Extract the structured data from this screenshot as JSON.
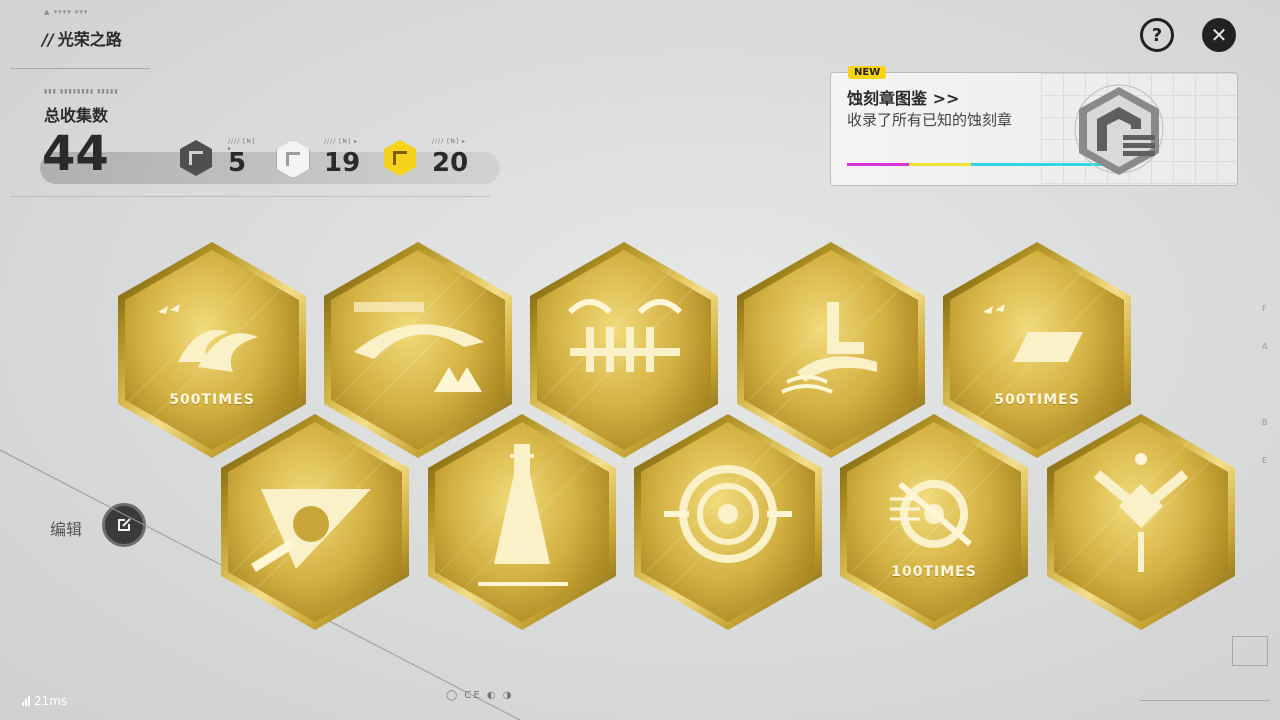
{
  "header": {
    "title_prefix": "//",
    "title": "光荣之路",
    "help_symbol": "?",
    "close_symbol": "✕",
    "logo_text": "▲ ▾▾▾▾ ▾▾▾"
  },
  "summary": {
    "label": "总收集数",
    "total": "44",
    "tiers": [
      {
        "name": "dark",
        "count": "5",
        "tiny": "//// [N] ▸"
      },
      {
        "name": "silver",
        "count": "19",
        "tiny": "//// [N] ▸"
      },
      {
        "name": "gold",
        "count": "20",
        "tiny": "//// [N] ▸"
      }
    ]
  },
  "codex": {
    "badge": "NEW",
    "title": "蚀刻章图鉴 >>",
    "description": "收录了所有已知的蚀刻章",
    "stripe_colors": [
      "#d632e0",
      "#f2e233",
      "#2fd7e6"
    ]
  },
  "edit": {
    "label": "编辑"
  },
  "badges": [
    {
      "id": "b1",
      "label": "500TIMES",
      "motif": "waves"
    },
    {
      "id": "b2",
      "label": "",
      "motif": "mountain"
    },
    {
      "id": "b3",
      "label": "",
      "motif": "pipes"
    },
    {
      "id": "b4",
      "label": "",
      "motif": "stairs"
    },
    {
      "id": "b5",
      "label": "500TIMES",
      "motif": "waves2"
    },
    {
      "id": "b6",
      "label": "",
      "motif": "triangle"
    },
    {
      "id": "b7",
      "label": "",
      "motif": "tower"
    },
    {
      "id": "b8",
      "label": "",
      "motif": "target"
    },
    {
      "id": "b9",
      "label": "100TIMES",
      "motif": "crosshair"
    },
    {
      "id": "b10",
      "label": "",
      "motif": "emblem"
    }
  ],
  "status": {
    "ping": "21ms"
  },
  "footer": {
    "marks": "◯  CE ◐ ◑"
  },
  "side_letters": [
    "F",
    "A",
    "B",
    "E"
  ],
  "colors": {
    "gold": "#d4b243",
    "tier_gold": "#f5d21b",
    "dark": "#2a2a2a"
  }
}
